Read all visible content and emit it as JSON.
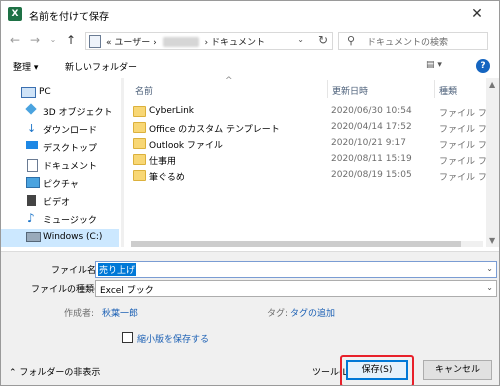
{
  "window": {
    "title": "名前を付けて保存",
    "app_icon_letter": "X"
  },
  "address": {
    "prefix": "«",
    "segment_user": "ユーザー",
    "sep": "›",
    "segment_docs": "ドキュメント",
    "dropdown": "⌄",
    "refresh": "↻"
  },
  "search": {
    "placeholder": "ドキュメントの検索"
  },
  "toolbar": {
    "organize": "整理 ▾",
    "new_folder": "新しいフォルダー",
    "view": "▤ ▾",
    "help": "?"
  },
  "nav_pane": {
    "items": [
      {
        "label": "PC"
      },
      {
        "label": "3D オブジェクト"
      },
      {
        "label": "ダウンロード"
      },
      {
        "label": "デスクトップ"
      },
      {
        "label": "ドキュメント"
      },
      {
        "label": "ピクチャ"
      },
      {
        "label": "ビデオ"
      },
      {
        "label": "ミュージック"
      },
      {
        "label": "Windows (C:)"
      }
    ]
  },
  "columns": {
    "name": "名前",
    "date": "更新日時",
    "type": "種類"
  },
  "files": [
    {
      "name": "CyberLink",
      "date": "2020/06/30 10:54",
      "type": "ファイル フォル"
    },
    {
      "name": "Office のカスタム テンプレート",
      "date": "2020/04/14 17:52",
      "type": "ファイル フォル"
    },
    {
      "name": "Outlook ファイル",
      "date": "2020/10/21 9:17",
      "type": "ファイル フォル"
    },
    {
      "name": "仕事用",
      "date": "2020/08/11 15:19",
      "type": "ファイル フォル"
    },
    {
      "name": "筆ぐるめ",
      "date": "2020/08/19 15:05",
      "type": "ファイル フォル"
    }
  ],
  "form": {
    "filename_label": "ファイル名(N):",
    "filename_value": "売り上げ",
    "filetype_label": "ファイルの種類(T):",
    "filetype_value": "Excel ブック",
    "author_label": "作成者:",
    "author_value": "秋葉一郎",
    "tags_label": "タグ:",
    "tags_value": "タグの追加",
    "thumbnail_label": "縮小版を保存する"
  },
  "footer": {
    "hide_folders": "フォルダーの非表示",
    "tools": "ツール(L)",
    "save": "保存(S)",
    "cancel": "キャンセル"
  },
  "colors": {
    "accent": "#0078d7",
    "highlight_box": "#e8202a",
    "selection": "#cce8ff"
  }
}
